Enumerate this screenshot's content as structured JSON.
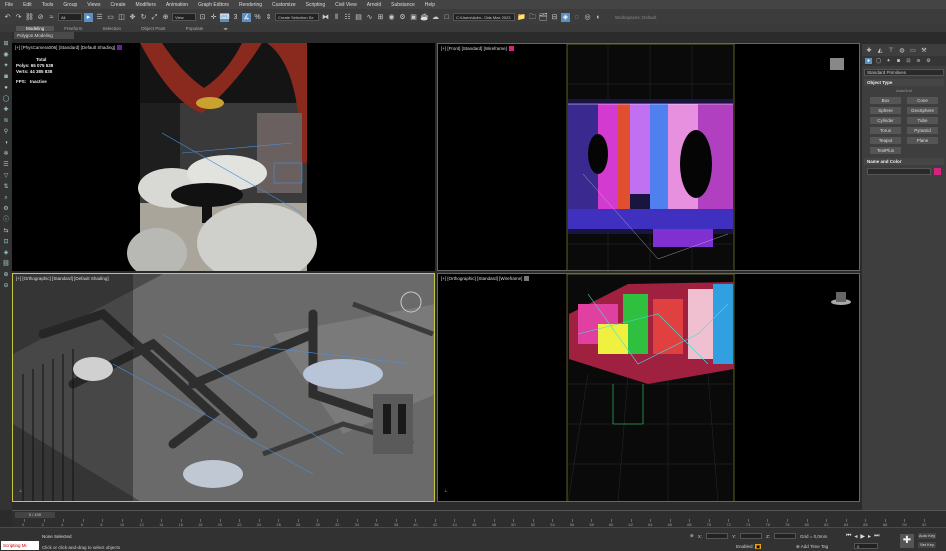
{
  "menu": [
    "File",
    "Edit",
    "Tools",
    "Group",
    "Views",
    "Create",
    "Modifiers",
    "Animation",
    "Graph Editors",
    "Rendering",
    "Customize",
    "Scripting",
    "Civil View",
    "Arnold",
    "Substance",
    "Help"
  ],
  "toolbar": {
    "selection_filter": "All",
    "ref_coord": "View",
    "named_selection": "Create Selection Se",
    "project_path": "C:\\Users\\Adm...\\3ds Max 2023",
    "workspace": "Workspaces: Default"
  },
  "ribbon": {
    "tabs": [
      "Modeling",
      "Freeform",
      "Selection",
      "Object Paint",
      "Populate"
    ],
    "active": "Modeling",
    "sub_label": "Polygon Modeling"
  },
  "viewports": {
    "top_left": {
      "label": "[+] [PhysCamera006] [Standard] [Default Shading]",
      "stats": {
        "total": "Total",
        "polys_label": "Polys:",
        "polys": "65 075 538",
        "verts_label": "Verts:",
        "verts": "44 385 838",
        "fps_label": "FPS:",
        "fps": "Inactive"
      }
    },
    "top_right": {
      "label": "[+] [Front] [Standard] [Wireframe]"
    },
    "bottom_left": {
      "label": "[+] [Orthographic] [Standard] [Default Shading]"
    },
    "bottom_right": {
      "label": "[+] [Orthographic] [Standard] [Wireframe]"
    }
  },
  "command_panel": {
    "category": "Standard Primitives",
    "object_type_title": "Object Type",
    "autogrid": "AutoGrid",
    "objects": [
      "Box",
      "Cone",
      "Sphere",
      "GeoSphere",
      "Cylinder",
      "Tube",
      "Torus",
      "Pyramid",
      "Teapot",
      "Plane",
      "TextPlus"
    ],
    "name_color_title": "Name and Color",
    "color": "#d0257a"
  },
  "timeline": {
    "slider": "0 / 100",
    "ticks": [
      "0",
      "2",
      "4",
      "6",
      "8",
      "10",
      "12",
      "14",
      "16",
      "18",
      "20",
      "22",
      "24",
      "26",
      "28",
      "30",
      "32",
      "34",
      "36",
      "38",
      "40",
      "42",
      "44",
      "46",
      "48",
      "50",
      "52",
      "54",
      "56",
      "58",
      "60",
      "62",
      "64",
      "66",
      "68",
      "70",
      "72",
      "74",
      "76",
      "78",
      "80",
      "82",
      "84",
      "86",
      "88",
      "90",
      "92"
    ]
  },
  "statusbar": {
    "script": "Scripting Mi",
    "selected": "None Selected",
    "hint": "Click or click-and-drag to select objects",
    "x_label": "X:",
    "y_label": "Y:",
    "z_label": "Z:",
    "grid": "Grid = 0,0mm",
    "enabled": "Enabled:",
    "add_time_tag": "Add Time Tag",
    "frame": "0",
    "auto_key": "Auto Key",
    "set_key": "Set Key"
  }
}
